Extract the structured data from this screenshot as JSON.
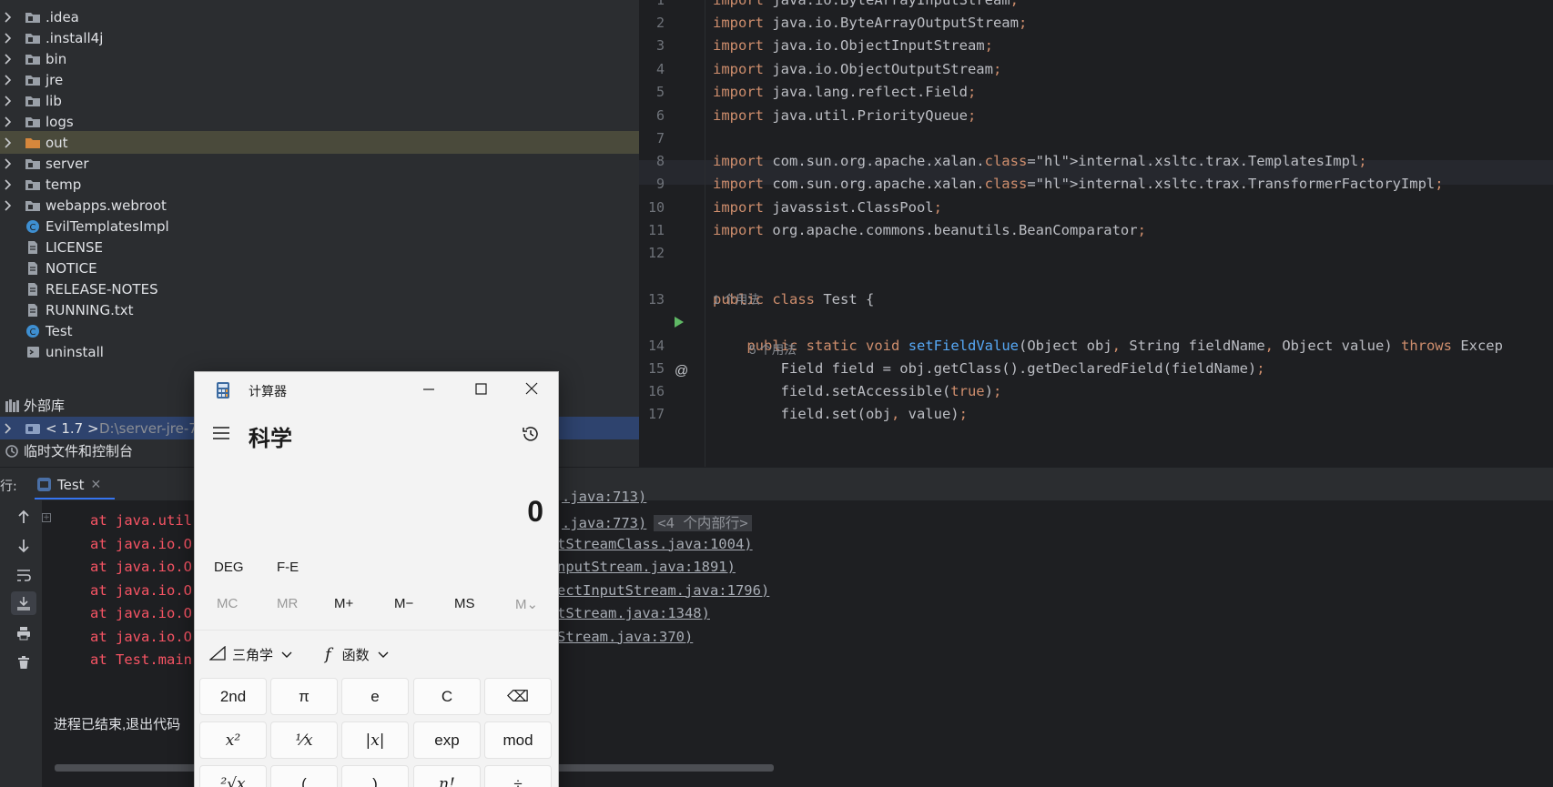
{
  "project_tree": {
    "items": [
      {
        "label": ".idea",
        "icon": "folder-icon",
        "expandable": true
      },
      {
        "label": ".install4j",
        "icon": "folder-icon",
        "expandable": true
      },
      {
        "label": "bin",
        "icon": "folder-icon",
        "expandable": true
      },
      {
        "label": "jre",
        "icon": "folder-icon",
        "expandable": true
      },
      {
        "label": "lib",
        "icon": "folder-icon",
        "expandable": true
      },
      {
        "label": "logs",
        "icon": "folder-icon",
        "expandable": true
      },
      {
        "label": "out",
        "icon": "orange-folder-icon",
        "expandable": true
      },
      {
        "label": "server",
        "icon": "folder-icon",
        "expandable": true
      },
      {
        "label": "temp",
        "icon": "folder-icon",
        "expandable": true
      },
      {
        "label": "webapps.webroot",
        "icon": "folder-icon",
        "expandable": true
      },
      {
        "label": "EvilTemplatesImpl",
        "icon": "class-icon",
        "expandable": false
      },
      {
        "label": "LICENSE",
        "icon": "text-file-icon",
        "expandable": false
      },
      {
        "label": "NOTICE",
        "icon": "text-file-icon",
        "expandable": false
      },
      {
        "label": "RELEASE-NOTES",
        "icon": "text-file-icon",
        "expandable": false
      },
      {
        "label": "RUNNING.txt",
        "icon": "text-file-icon",
        "expandable": false
      },
      {
        "label": "Test",
        "icon": "class-icon",
        "expandable": false
      },
      {
        "label": "uninstall",
        "icon": "script-file-icon",
        "expandable": false
      }
    ],
    "external_libs": "外部库",
    "jdk_label": "< 1.7 >",
    "jdk_path": "D:\\server-jre-7",
    "scratches": "临时文件和控制台"
  },
  "editor": {
    "lines": [
      {
        "n": "1",
        "text": "import java.io.ByteArrayInputStream;"
      },
      {
        "n": "2",
        "text": "import java.io.ByteArrayOutputStream;"
      },
      {
        "n": "3",
        "text": "import java.io.ObjectInputStream;"
      },
      {
        "n": "4",
        "text": "import java.io.ObjectOutputStream;"
      },
      {
        "n": "5",
        "text": "import java.lang.reflect.Field;"
      },
      {
        "n": "6",
        "text": "import java.util.PriorityQueue;"
      },
      {
        "n": "7",
        "text": ""
      },
      {
        "n": "8",
        "text": "import com.sun.org.apache.xalan.internal.xsltc.trax.TemplatesImpl;"
      },
      {
        "n": "9",
        "text": "import com.sun.org.apache.xalan.internal.xsltc.trax.TransformerFactoryImpl;"
      },
      {
        "n": "10",
        "text": "import javassist.ClassPool;"
      },
      {
        "n": "11",
        "text": "import org.apache.commons.beanutils.BeanComparator;"
      },
      {
        "n": "12",
        "text": ""
      },
      {
        "n": "13",
        "text": "public class Test {"
      },
      {
        "n": "14",
        "text": "    public static void setFieldValue(Object obj, String fieldName, Object value) throws Excep"
      },
      {
        "n": "15",
        "text": "        Field field = obj.getClass().getDeclaredField(fieldName);"
      },
      {
        "n": "16",
        "text": "        field.setAccessible(true);"
      },
      {
        "n": "17",
        "text": "        field.set(obj, value);"
      }
    ],
    "usages_1": "1 个用法",
    "usages_5": "5 个用法"
  },
  "run_panel": {
    "label": "行:",
    "tab": "Test",
    "console": [
      {
        "prefix": "at java.util",
        "link": ".java:773)",
        "fold": "<4 个内部行>"
      },
      {
        "prefix": "at java.io.O",
        "link": "tStreamClass.java:1004)",
        "fold": ""
      },
      {
        "prefix": "at java.io.O",
        "link": "nputStream.java:1891)",
        "fold": ""
      },
      {
        "prefix": "at java.io.O",
        "link": "ectInputStream.java:1796)",
        "fold": ""
      },
      {
        "prefix": "at java.io.O",
        "link": "tStream.java:1348)",
        "fold": ""
      },
      {
        "prefix": "at java.io.O",
        "link": "Stream.java:370)",
        "fold": ""
      },
      {
        "prefix": "at Test.main",
        "link": "",
        "fold": ""
      }
    ],
    "top_partial_link": ".java:713)",
    "exit_text": "进程已结束,退出代码"
  },
  "calculator": {
    "title": "计算器",
    "mode": "科学",
    "display": "0",
    "deg": "DEG",
    "fe": "F-E",
    "memory": [
      "MC",
      "MR",
      "M+",
      "M−",
      "MS",
      "M⌄"
    ],
    "trig_label": "三角学",
    "func_label": "函数",
    "keys_row1": [
      "2nd",
      "π",
      "e",
      "C",
      "⌫"
    ],
    "keys_row2": [
      "x²",
      "¹⁄x",
      "|x|",
      "exp",
      "mod"
    ],
    "keys_row3": [
      "²√x",
      "(",
      ")",
      "n!",
      "÷"
    ]
  },
  "colors": {
    "keyword": "#cf8e6d",
    "function": "#56a8f5",
    "error": "#f75464",
    "tree_selected_out": "#4a4a3b",
    "tree_selected_jdk": "#2e436e"
  }
}
